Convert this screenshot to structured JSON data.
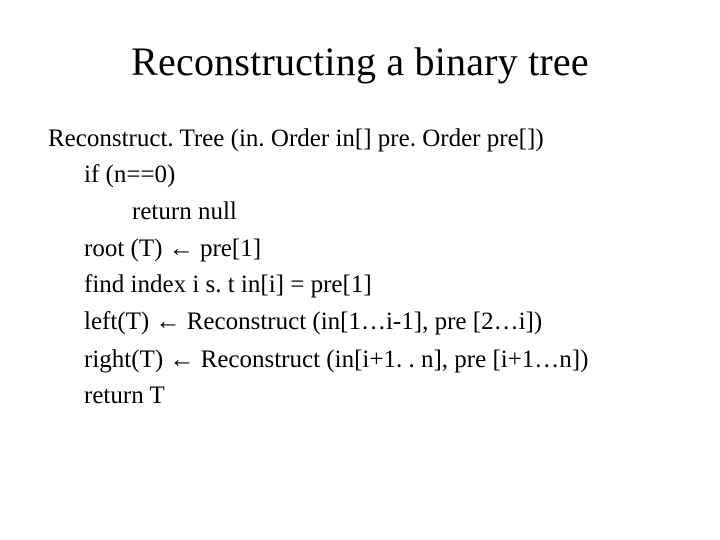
{
  "title": "Reconstructing a binary tree",
  "lines": {
    "l0": "Reconstruct. Tree (in. Order in[] pre. Order pre[])",
    "l1": "if (n==0)",
    "l2": "return null",
    "l3a": "root (T) ",
    "l3b": " pre[1]",
    "l4": "find index i s. t in[i] = pre[1]",
    "l5a": "left(T) ",
    "l5b": " Reconstruct (in[1…i-1], pre [2…i])",
    "l6a": "right(T) ",
    "l6b": " Reconstruct (in[i+1. . n], pre [i+1…n])",
    "l7": "return T"
  },
  "arrow": "←"
}
